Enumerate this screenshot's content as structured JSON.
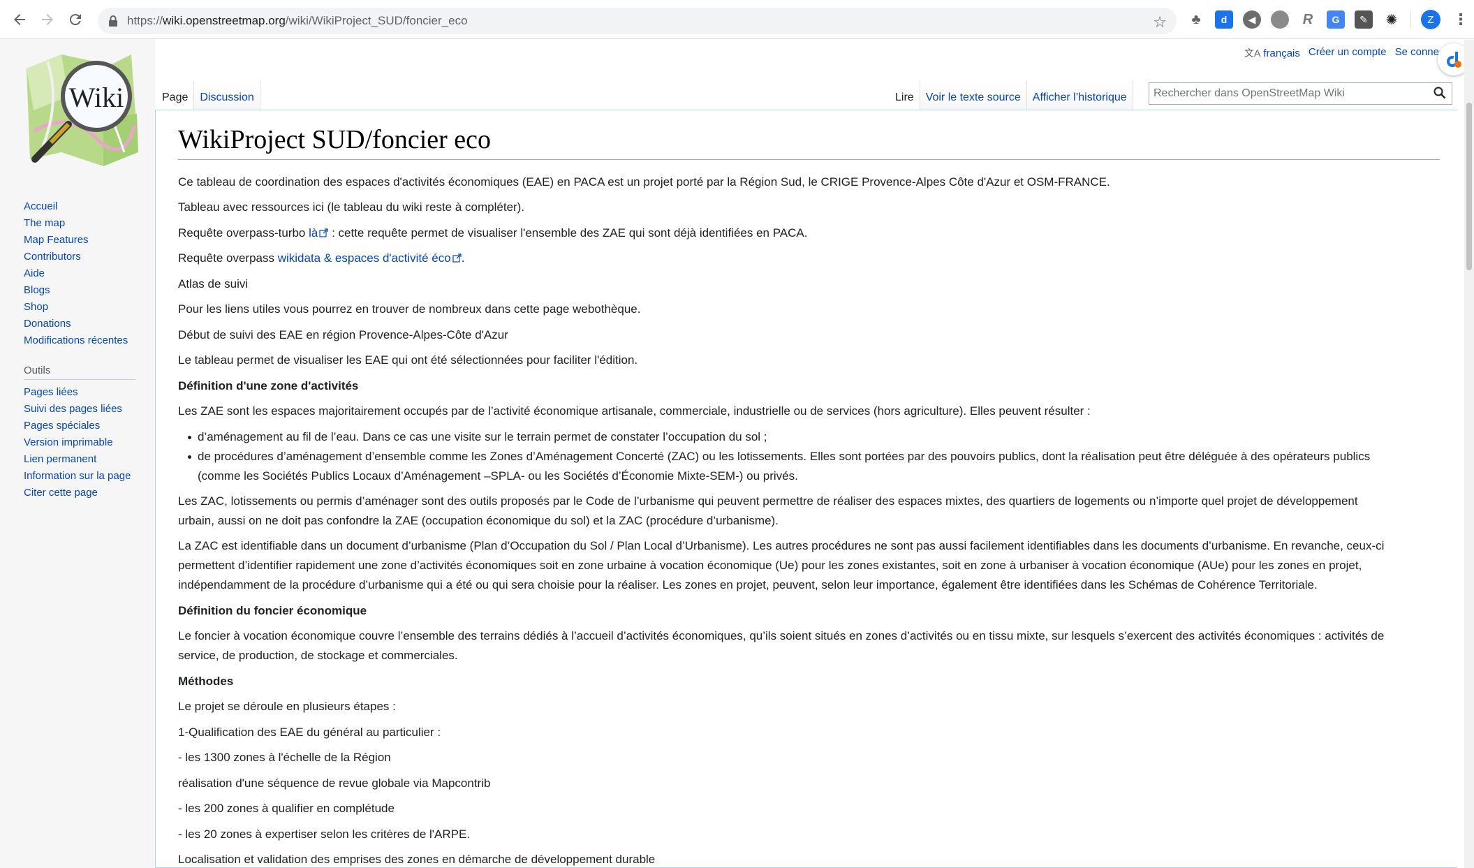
{
  "browser": {
    "url_scheme": "https://",
    "url_host": "wiki.openstreetmap.org",
    "url_path": "/wiki/WikiProject_SUD/foncier_eco",
    "profile_initial": "Z"
  },
  "personal": {
    "language": "français",
    "create_account": "Créer un compte",
    "login": "Se conne"
  },
  "tabs": {
    "page": "Page",
    "discussion": "Discussion",
    "read": "Lire",
    "view_source": "Voir le texte source",
    "history": "Afficher l’historique"
  },
  "search": {
    "placeholder": "Rechercher dans OpenStreetMap Wiki"
  },
  "logo": {
    "text": "Wiki"
  },
  "sidebar": {
    "nav": [
      "Accueil",
      "The map",
      "Map Features",
      "Contributors",
      "Aide",
      "Blogs",
      "Shop",
      "Donations",
      "Modifications récentes"
    ],
    "tools_heading": "Outils",
    "tools": [
      "Pages liées",
      "Suivi des pages liées",
      "Pages spéciales",
      "Version imprimable",
      "Lien permanent",
      "Information sur la page",
      "Citer cette page"
    ]
  },
  "article": {
    "title": "WikiProject SUD/foncier eco",
    "p1": "Ce tableau de coordination des espaces d'activités économiques (EAE) en PACA est un projet porté par la Région Sud, le CRIGE Provence-Alpes Côte d'Azur et OSM-FRANCE.",
    "p2": "Tableau avec ressources ici (le tableau du wiki reste à compléter).",
    "p3_before": "Requête overpass-turbo ",
    "p3_link": "là",
    "p3_after": " : cette requête permet de visualiser l'ensemble des ZAE qui sont déjà identifiées en PACA.",
    "p4_before": "Requête overpass ",
    "p4_link": "wikidata & espaces d'activité éco",
    "p4_after": ".",
    "p5": "Atlas de suivi",
    "p6": "Pour les liens utiles vous pourrez en trouver de nombreux dans cette page webothèque.",
    "p7": "Début de suivi des EAE en région Provence-Alpes-Côte d'Azur",
    "p8": "Le tableau permet de visualiser les EAE qui ont été sélectionnées pour faciliter l'édition.",
    "h_zone": "Définition d'une zone d'activités",
    "p9": "Les ZAE sont les espaces majoritairement occupés par de l’activité économique artisanale, commerciale, industrielle ou de services (hors agriculture). Elles peuvent résulter :",
    "li1": "d’aménagement au fil de l’eau. Dans ce cas une visite sur le terrain permet de constater l’occupation du sol ;",
    "li2a": "de procédures d’aménagement d’ensemble comme les Zones d’Aménagement Concerté (ZAC) ou les lotissements. Elles sont portées par des pouvoirs publics, dont la réalisation peut être déléguée à des opérateurs publics",
    "li2b": "(comme les Sociétés Publics Locaux d’Aménagement –SPLA- ou les Sociétés d’Économie Mixte-SEM-) ou privés.",
    "p10a": "Les ZAC, lotissements ou permis d’aménager sont des outils proposés par le Code de l’urbanisme qui peuvent permettre de réaliser des espaces mixtes, des quartiers de logements ou n’importe quel projet de développement",
    "p10b": "urbain, aussi on ne doit pas confondre la ZAE (occupation économique du sol) et la ZAC (procédure d’urbanisme).",
    "p11a": "La ZAC est identifiable dans un document d’urbanisme (Plan d’Occupation du Sol / Plan Local d’Urbanisme). Les autres procédures ne sont pas aussi facilement identifiables dans les documents d’urbanisme. En revanche, ceux-ci",
    "p11b": "permettent d’identifier rapidement une zone d’activités économiques soit en zone urbaine à vocation économique (Ue) pour les zones existantes, soit en zone à urbaniser à vocation économique (AUe) pour les zones en projet,",
    "p11c": "indépendamment de la procédure d’urbanisme qui a été ou qui sera choisie pour la réaliser. Les zones en projet, peuvent, selon leur importance, également être identifiées dans les Schémas de Cohérence Territoriale.",
    "h_foncier": "Définition du foncier économique",
    "p12a": "Le foncier à vocation économique couvre l’ensemble des terrains dédiés à l’accueil d’activités économiques, qu’ils soient situés en zones d’activités ou en tissu mixte, sur lesquels s’exercent des activités économiques : activités de",
    "p12b": "service, de production, de stockage et commerciales.",
    "h_methodes": "Méthodes",
    "p13": "Le projet se déroule en plusieurs étapes :",
    "p14": "1-Qualification des EAE du général au particulier :",
    "p15": "- les 1300 zones à l'échelle de la Région",
    "p16": "réalisation d'une séquence de revue globale via Mapcontrib",
    "p17": "- les 200 zones à qualifier en complétude",
    "p18": "- les 20 zones à expertiser selon les critères de l'ARPE.",
    "p19": "Localisation et validation des emprises des zones en démarche de développement durable"
  }
}
